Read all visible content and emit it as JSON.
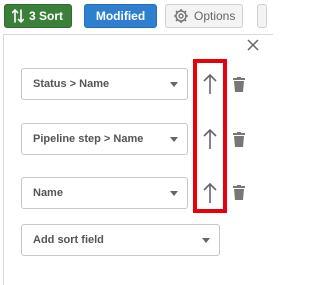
{
  "toolbar": {
    "sort_label": "3 Sort",
    "modified_label": "Modified",
    "options_label": "Options"
  },
  "sort_panel": {
    "fields": [
      {
        "value": "Status > Name",
        "direction": "ascending"
      },
      {
        "value": "Pipeline step > Name",
        "direction": "ascending"
      },
      {
        "value": "Name",
        "direction": "ascending"
      }
    ],
    "add_field_label": "Add sort field"
  },
  "colors": {
    "sort_button": "#3b7f3b",
    "modified_button": "#2f7fd0",
    "highlight": "#e8000b"
  },
  "icons": [
    "sort-icon",
    "gear-icon",
    "close-icon",
    "sort-ascending-arrow-icon",
    "trash-icon",
    "chevron-down-icon"
  ]
}
